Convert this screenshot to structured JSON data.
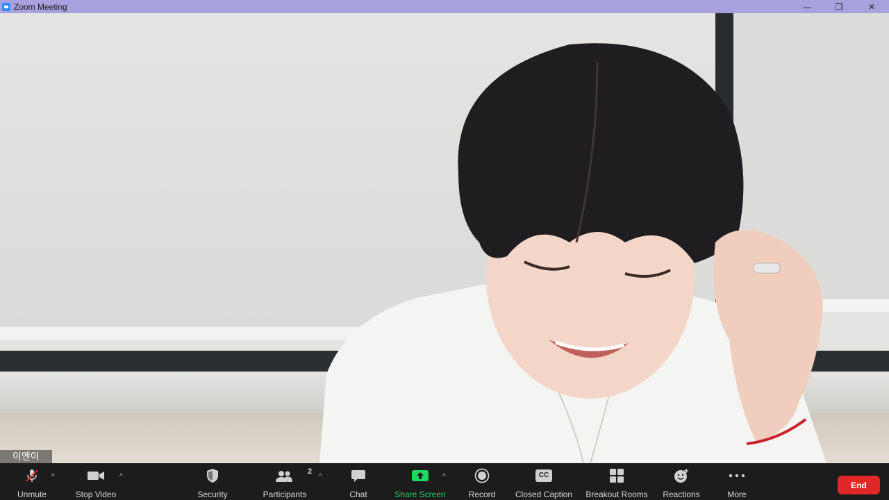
{
  "window": {
    "title": "Zoom Meeting",
    "minimize_glyph": "—",
    "restore_glyph": "❐",
    "close_glyph": "✕"
  },
  "participant": {
    "name": "이엔이"
  },
  "toolbar": {
    "unmute": "Unmute",
    "stop_video": "Stop Video",
    "security": "Security",
    "participants": "Participants",
    "participants_count": "2",
    "chat": "Chat",
    "share_screen": "Share Screen",
    "record": "Record",
    "closed_caption": "Closed Caption",
    "cc_badge": "CC",
    "breakout_rooms": "Breakout Rooms",
    "reactions": "Reactions",
    "more": "More",
    "end": "End",
    "caret": "^"
  },
  "colors": {
    "titlebar": "#a7a1de",
    "toolbar": "#1c1c1c",
    "share_green": "#1ed760",
    "end_red": "#e02828"
  }
}
